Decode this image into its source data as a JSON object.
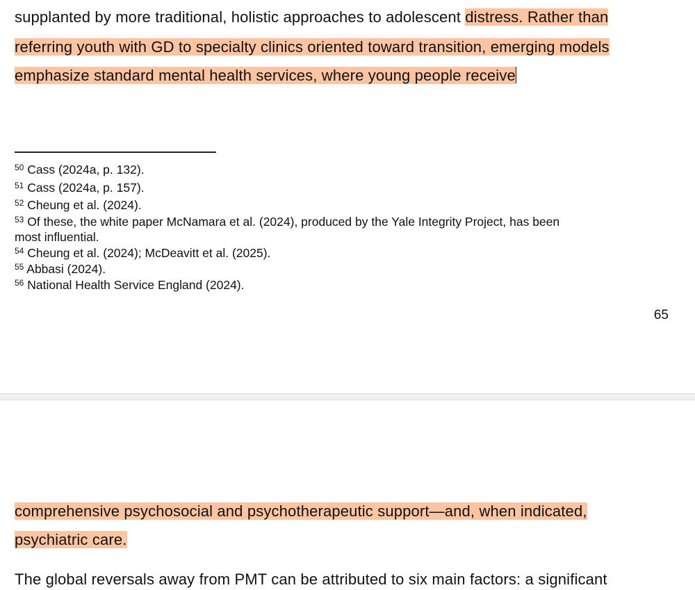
{
  "page_top": {
    "body_lines": [
      {
        "plain": "supplanted by more traditional, holistic approaches to adolescent ",
        "highlighted": "distress. Rather than"
      },
      {
        "plain": "",
        "highlighted": "referring youth with GD to specialty clinics oriented toward transition, emerging models"
      },
      {
        "plain": "",
        "highlighted": "emphasize standard mental health services, where young people receive"
      }
    ],
    "footnotes": [
      {
        "num": "50",
        "text": "Cass (2024a, p. 132)."
      },
      {
        "num": "51",
        "text": " Cass (2024a, p. 157)."
      },
      {
        "num": "52",
        "text": "Cheung et al. (2024)."
      },
      {
        "num": "53",
        "text": "Of these, the white paper McNamara et al. (2024), produced by the Yale Integrity Project, has been"
      },
      {
        "num": "",
        "text": "most influential."
      },
      {
        "num": "54",
        "text": "Cheung et al. (2024); McDeavitt et al. (2025)."
      },
      {
        "num": "55",
        "text": "Abbasi (2024)."
      },
      {
        "num": "56",
        "text": "National Health Service England (2024)."
      }
    ],
    "page_number": "65"
  },
  "page_bottom": {
    "body_lines": [
      {
        "highlighted": "comprehensive psychosocial and psychotherapeutic support—and, when indicated,"
      },
      {
        "highlighted": "psychiatric care."
      }
    ],
    "cut_off_line": "The global reversals away from PMT can be attributed to six main factors: a significant"
  },
  "colors": {
    "highlight": "#fcc4a1",
    "page_gap": "#f1f1f1",
    "text": "#111111"
  }
}
